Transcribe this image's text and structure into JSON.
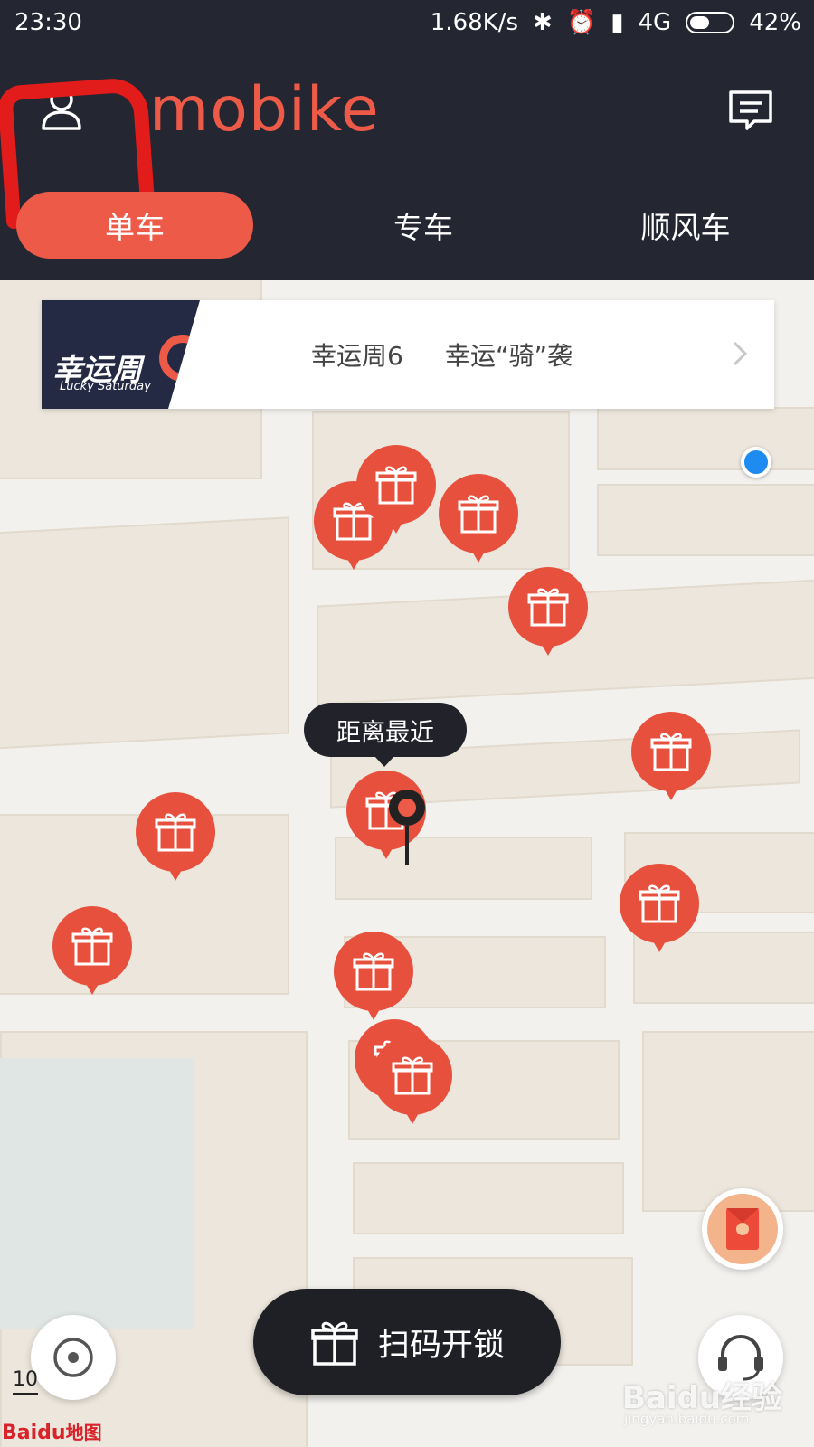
{
  "status_bar": {
    "time": "23:30",
    "net_speed": "1.68K/s",
    "network": "4G",
    "battery": "42%"
  },
  "header": {
    "logo": "mobike",
    "tabs": [
      {
        "label": "单车",
        "active": true
      },
      {
        "label": "专车",
        "active": false
      },
      {
        "label": "顺风车",
        "active": false
      }
    ]
  },
  "banner": {
    "badge_title": "幸运周",
    "badge_subtitle": "Lucky Saturday",
    "text_1": "幸运周6",
    "text_2": "幸运“骑”袭"
  },
  "map": {
    "nearest_label": "距离最近",
    "scale_text": "10",
    "attribution_brand": "Baidu",
    "attribution_map": "地图"
  },
  "bottom": {
    "scan_label": "扫码开锁"
  },
  "watermark": {
    "brand": "Baidu经验",
    "url": "jingyan.baidu.com"
  },
  "colors": {
    "header_bg": "#242631",
    "accent": "#ee5a48",
    "scan_button_bg": "#1f2026",
    "location_dot": "#1d8bf0"
  },
  "icons": [
    "user-icon",
    "message-icon",
    "chevron-right-icon",
    "gift-icon",
    "map-pin-icon",
    "locate-icon",
    "customer-service-icon",
    "red-packet-icon"
  ]
}
